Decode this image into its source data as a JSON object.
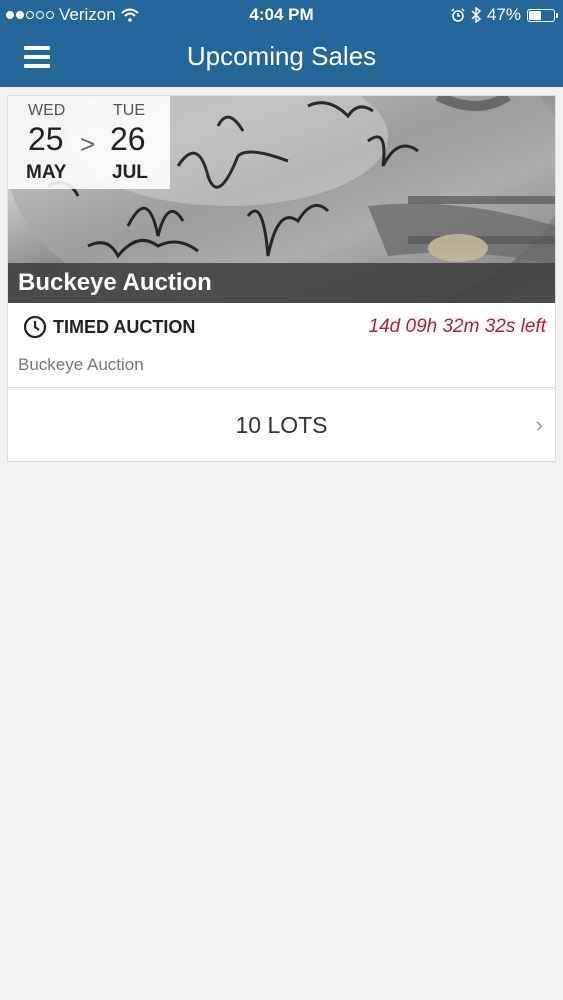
{
  "status_bar": {
    "carrier": "Verizon",
    "time": "4:04 PM",
    "battery_percent": "47%",
    "battery_level": 0.47
  },
  "header": {
    "title": "Upcoming Sales",
    "background": "#24679a",
    "icons": [
      "menu-icon"
    ]
  },
  "sale": {
    "start": {
      "day_name": "WED",
      "day": "25",
      "month": "MAY"
    },
    "end": {
      "day_name": "TUE",
      "day": "26",
      "month": "JUL"
    },
    "date_separator": ">",
    "title": "Buckeye Auction",
    "type_label": "TIMED AUCTION",
    "countdown": "14d 09h 32m 32s left",
    "countdown_color": "#b22133",
    "subtitle": "Buckeye Auction",
    "lots_label": "10 LOTS",
    "chevron": "›",
    "image_description_icon": "helmet-image"
  }
}
